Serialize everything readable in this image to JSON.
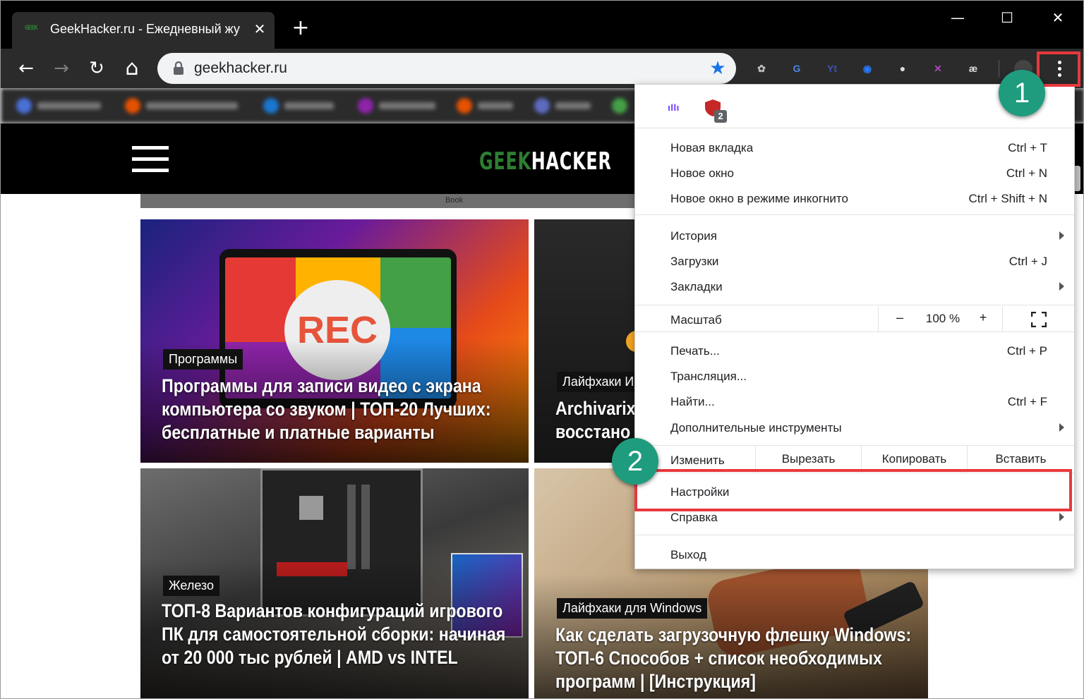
{
  "tab": {
    "favicon_text": "GEEK",
    "title": "GeekHacker.ru - Ежедневный жу",
    "close": "✕"
  },
  "new_tab": "+",
  "window_controls": {
    "minimize": "—",
    "maximize": "☐",
    "close": "✕"
  },
  "toolbar": {
    "back": "←",
    "forward": "→",
    "reload": "↻",
    "home": "⌂",
    "url": "geekhacker.ru",
    "star": "★"
  },
  "extensions": [
    {
      "name": "paw-extension-icon",
      "glyph": "✿",
      "color": "#bbbbbb"
    },
    {
      "name": "google-translate-icon",
      "glyph": "G",
      "color": "#4a86e8"
    },
    {
      "name": "yt-extension-icon",
      "glyph": "Yt",
      "color": "#3f51b5"
    },
    {
      "name": "vpn-extension-icon",
      "glyph": "◉",
      "color": "#2979ff"
    },
    {
      "name": "chat-extension-icon",
      "glyph": "●",
      "color": "#dddddd"
    },
    {
      "name": "x-extension-icon",
      "glyph": "✕",
      "color": "#ab47bc"
    },
    {
      "name": "ae-extension-icon",
      "glyph": "æ",
      "color": "#dddddd"
    }
  ],
  "site": {
    "logo_green": "GEEK",
    "logo_white": "HACKER",
    "book_label": "Book"
  },
  "cards": [
    {
      "badge": "Программы",
      "title": "Программы для записи видео с экрана компьютера со звуком | ТОП-20 Лучших: бесплатные и платные варианты",
      "rec": "REC"
    },
    {
      "badge": "Лайфхаки И",
      "title": "Archivarix восстано"
    },
    {
      "badge": "Железо",
      "title": "ТОП-8 Вариантов конфигураций игрового ПК для самостоятельной сборки: начиная от 20 000 тыс рублей | AMD vs INTEL"
    },
    {
      "badge": "Лайфхаки для Windows",
      "title": "Как сделать загрузочную флешку Windows: ТОП-6 Способов + список необходимых программ | [Инструкция]"
    }
  ],
  "menu": {
    "ublock_count": "2",
    "items_group1": [
      {
        "label": "Новая вкладка",
        "shortcut": "Ctrl + T"
      },
      {
        "label": "Новое окно",
        "shortcut": "Ctrl + N"
      },
      {
        "label": "Новое окно в режиме инкогнито",
        "shortcut": "Ctrl + Shift + N"
      }
    ],
    "items_group2": [
      {
        "label": "История",
        "shortcut": ""
      },
      {
        "label": "Загрузки",
        "shortcut": "Ctrl + J"
      },
      {
        "label": "Закладки",
        "shortcut": ""
      }
    ],
    "zoom": {
      "label": "Масштаб",
      "minus": "–",
      "value": "100 %",
      "plus": "+"
    },
    "items_group3": [
      {
        "label": "Печать...",
        "shortcut": "Ctrl + P"
      },
      {
        "label": "Трансляция...",
        "shortcut": ""
      },
      {
        "label": "Найти...",
        "shortcut": "Ctrl + F"
      },
      {
        "label": "Дополнительные инструменты",
        "shortcut": ""
      }
    ],
    "edit": {
      "label": "Изменить",
      "cut": "Вырезать",
      "copy": "Копировать",
      "paste": "Вставить"
    },
    "settings": "Настройки",
    "help": "Справка",
    "exit": "Выход"
  },
  "annotations": {
    "step1": "1",
    "step2": "2",
    "highlight_color": "#e8383d",
    "badge_color": "#1f9c7e"
  }
}
